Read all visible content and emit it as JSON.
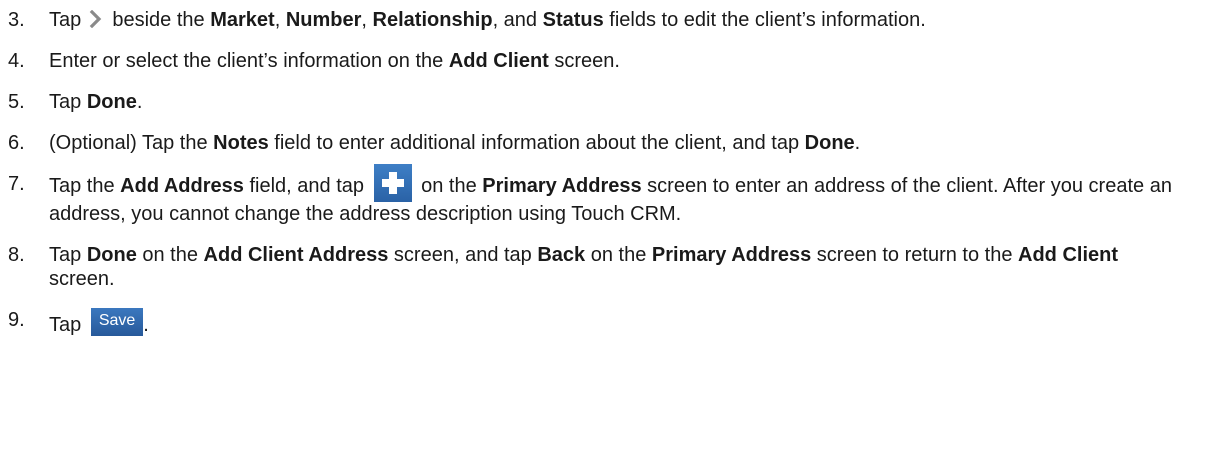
{
  "steps": [
    {
      "num": "3.",
      "parts": [
        {
          "t": "Tap "
        },
        {
          "icon": "chevron-right-icon"
        },
        {
          "t": " beside the "
        },
        {
          "b": "Market"
        },
        {
          "t": ", "
        },
        {
          "b": "Number"
        },
        {
          "t": ", "
        },
        {
          "b": "Relationship"
        },
        {
          "t": ", and "
        },
        {
          "b": "Status"
        },
        {
          "t": " fields to edit the client’s information."
        }
      ]
    },
    {
      "num": "4.",
      "parts": [
        {
          "t": "Enter or select the client’s information on the "
        },
        {
          "b": "Add Client"
        },
        {
          "t": " screen."
        }
      ]
    },
    {
      "num": "5.",
      "parts": [
        {
          "t": "Tap "
        },
        {
          "b": "Done"
        },
        {
          "t": "."
        }
      ]
    },
    {
      "num": "6.",
      "parts": [
        {
          "t": "(Optional) Tap the "
        },
        {
          "b": "Notes"
        },
        {
          "t": " field to enter additional information about the client, and tap "
        },
        {
          "b": "Done"
        },
        {
          "t": "."
        }
      ]
    },
    {
      "num": "7.",
      "parts": [
        {
          "t": "Tap the "
        },
        {
          "b": "Add Address"
        },
        {
          "t": " field, and tap "
        },
        {
          "icon": "plus-icon"
        },
        {
          "t": " on the "
        },
        {
          "b": "Primary Address"
        },
        {
          "t": " screen to enter an address of the client. After you create an address, you cannot change the address description using Touch CRM."
        }
      ]
    },
    {
      "num": "8.",
      "parts": [
        {
          "t": "Tap "
        },
        {
          "b": "Done"
        },
        {
          "t": " on the "
        },
        {
          "b": "Add Client Address"
        },
        {
          "t": " screen, and tap "
        },
        {
          "b": "Back"
        },
        {
          "t": " on the "
        },
        {
          "b": "Primary Address"
        },
        {
          "t": " screen to return to the "
        },
        {
          "b": "Add Client"
        },
        {
          "t": " screen."
        }
      ]
    },
    {
      "num": "9.",
      "parts": [
        {
          "t": "Tap "
        },
        {
          "button": "Save"
        },
        {
          "t": "."
        }
      ]
    }
  ],
  "colors": {
    "text": "#1a1a1a",
    "accent_blue": "#2f6db3",
    "chevron_gray": "#8a8a8a"
  }
}
